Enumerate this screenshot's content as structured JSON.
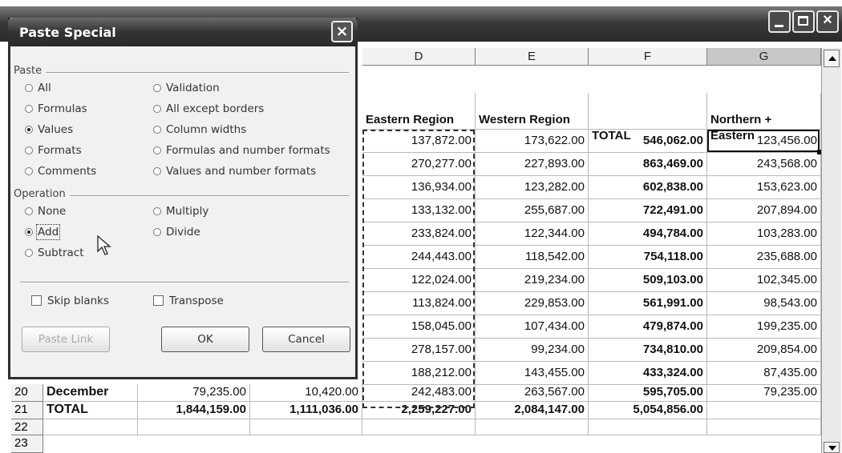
{
  "window": {
    "controls": [
      "minimize-icon",
      "maximize-icon",
      "close-icon"
    ]
  },
  "columns": [
    {
      "letter": "D"
    },
    {
      "letter": "E"
    },
    {
      "letter": "F"
    },
    {
      "letter": "G",
      "selected": true
    }
  ],
  "headers": {
    "d": "Eastern Region",
    "e": "Western Region",
    "f": "TOTAL",
    "g": "Northern + Eastern"
  },
  "rows": [
    {
      "d": "137,872.00",
      "e": "173,622.00",
      "f": "546,062.00",
      "g": "123,456.00"
    },
    {
      "d": "270,277.00",
      "e": "227,893.00",
      "f": "863,469.00",
      "g": "243,568.00"
    },
    {
      "d": "136,934.00",
      "e": "123,282.00",
      "f": "602,838.00",
      "g": "153,623.00"
    },
    {
      "d": "133,132.00",
      "e": "255,687.00",
      "f": "722,491.00",
      "g": "207,894.00"
    },
    {
      "d": "233,824.00",
      "e": "122,344.00",
      "f": "494,784.00",
      "g": "103,283.00"
    },
    {
      "d": "244,443.00",
      "e": "118,542.00",
      "f": "754,118.00",
      "g": "235,688.00"
    },
    {
      "d": "122,024.00",
      "e": "219,234.00",
      "f": "509,103.00",
      "g": "102,345.00"
    },
    {
      "d": "113,824.00",
      "e": "229,853.00",
      "f": "561,991.00",
      "g": "98,543.00"
    },
    {
      "d": "158,045.00",
      "e": "107,434.00",
      "f": "479,874.00",
      "g": "199,235.00"
    },
    {
      "d": "278,157.00",
      "e": "99,234.00",
      "f": "734,810.00",
      "g": "209,854.00"
    },
    {
      "d": "188,212.00",
      "e": "143,455.00",
      "f": "433,324.00",
      "g": "87,435.00"
    }
  ],
  "row20": {
    "num": "20",
    "label": "December",
    "b": "79,235.00",
    "c": "10,420.00",
    "d": "242,483.00",
    "e": "263,567.00",
    "f": "595,705.00",
    "g": "79,235.00"
  },
  "row21": {
    "num": "21",
    "label": "TOTAL",
    "b": "1,844,159.00",
    "c": "1,111,036.00",
    "d": "2,259,227.00",
    "e": "2,084,147.00",
    "f": "5,054,856.00",
    "g": ""
  },
  "row22": {
    "num": "22"
  },
  "row23": {
    "num": "23"
  },
  "dialog": {
    "title": "Paste Special",
    "paste_label": "Paste",
    "paste_options": {
      "all": "All",
      "formulas": "Formulas",
      "values": "Values",
      "formats": "Formats",
      "comments": "Comments",
      "validation": "Validation",
      "all_except_borders": "All except borders",
      "column_widths": "Column widths",
      "formulas_number_formats": "Formulas and number formats",
      "values_number_formats": "Values and number formats"
    },
    "operation_label": "Operation",
    "operation_options": {
      "none": "None",
      "add": "Add",
      "subtract": "Subtract",
      "multiply": "Multiply",
      "divide": "Divide"
    },
    "skip_blanks": "Skip blanks",
    "transpose": "Transpose",
    "paste_link": "Paste Link",
    "ok": "OK",
    "cancel": "Cancel",
    "selected_paste": "Values",
    "selected_operation": "Add"
  }
}
